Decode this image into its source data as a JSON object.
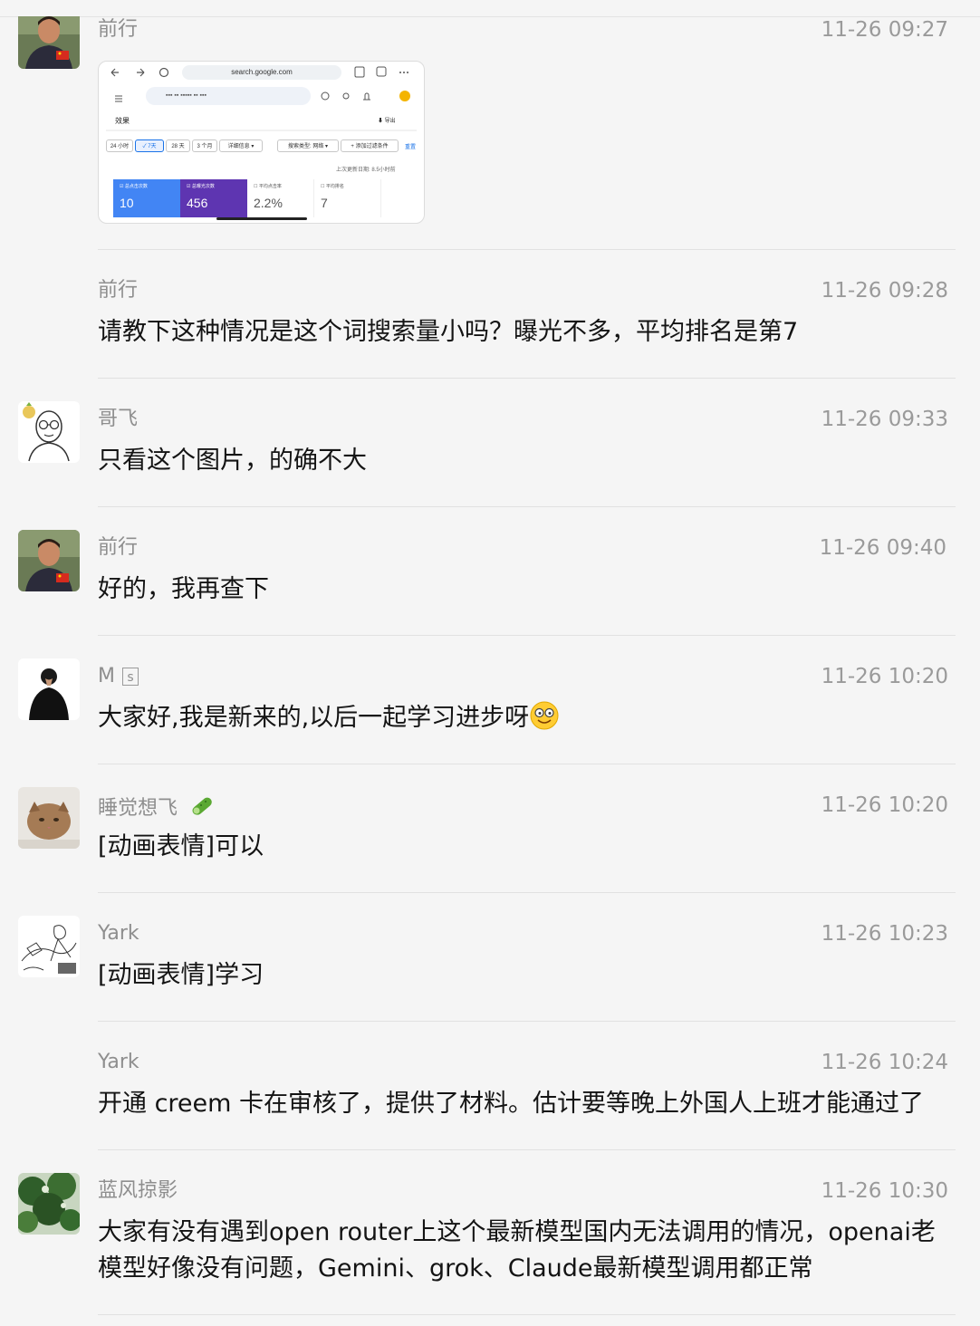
{
  "messages": [
    {
      "sender": "前行",
      "time": "11-26 09:27",
      "text": ""
    },
    {
      "sender": "前行",
      "time": "11-26 09:28",
      "text": "请教下这种情况是这个词搜索量小吗？曝光不多，平均排名是第7"
    },
    {
      "sender": "哥飞",
      "time": "11-26 09:33",
      "text": "只看这个图片，的确不大"
    },
    {
      "sender": "前行",
      "time": "11-26 09:40",
      "text": "好的，我再查下"
    },
    {
      "sender": "M",
      "sender_badge": "s",
      "time": "11-26 10:20",
      "text": "大家好,我是新来的,以后一起学习进步呀"
    },
    {
      "sender": "睡觉想飞",
      "time": "11-26 10:20",
      "text": "[动画表情]可以"
    },
    {
      "sender": "Yark",
      "time": "11-26 10:23",
      "text": "[动画表情]学习"
    },
    {
      "sender": "Yark",
      "time": "11-26 10:24",
      "text": "开通 creem 卡在审核了，提供了材料。估计要等晚上外国人上班才能通过了"
    },
    {
      "sender": "蓝风掠影",
      "time": "11-26 10:30",
      "text": "大家有没有遇到open router上这个最新模型国内无法调用的情况，openai老模型好像没有问题，Gemini、grok、Claude最新模型调用都正常"
    }
  ],
  "thumbnail": {
    "url": "search.google.com",
    "section_title": "效果",
    "export_label": "导出",
    "date_chips": [
      "24 小时",
      "✓ 7天",
      "28 天",
      "3 个月",
      "详细信息 ▾"
    ],
    "filter_chips": [
      "搜索类型: 网络 ▾",
      "+ 添加过滤条件"
    ],
    "reset_label": "重置",
    "last_updated": "上次更新日期: 8.5小时前",
    "metrics": [
      {
        "label": "总点击次数",
        "value": "10"
      },
      {
        "label": "总曝光次数",
        "value": "456"
      },
      {
        "label": "平均点击率",
        "value": "2.2%"
      },
      {
        "label": "平均排名",
        "value": "7"
      }
    ]
  },
  "colors": {
    "background": "#f5f5f5",
    "clicks_card": "#4285f4",
    "impressions_card": "#5e35b1"
  }
}
